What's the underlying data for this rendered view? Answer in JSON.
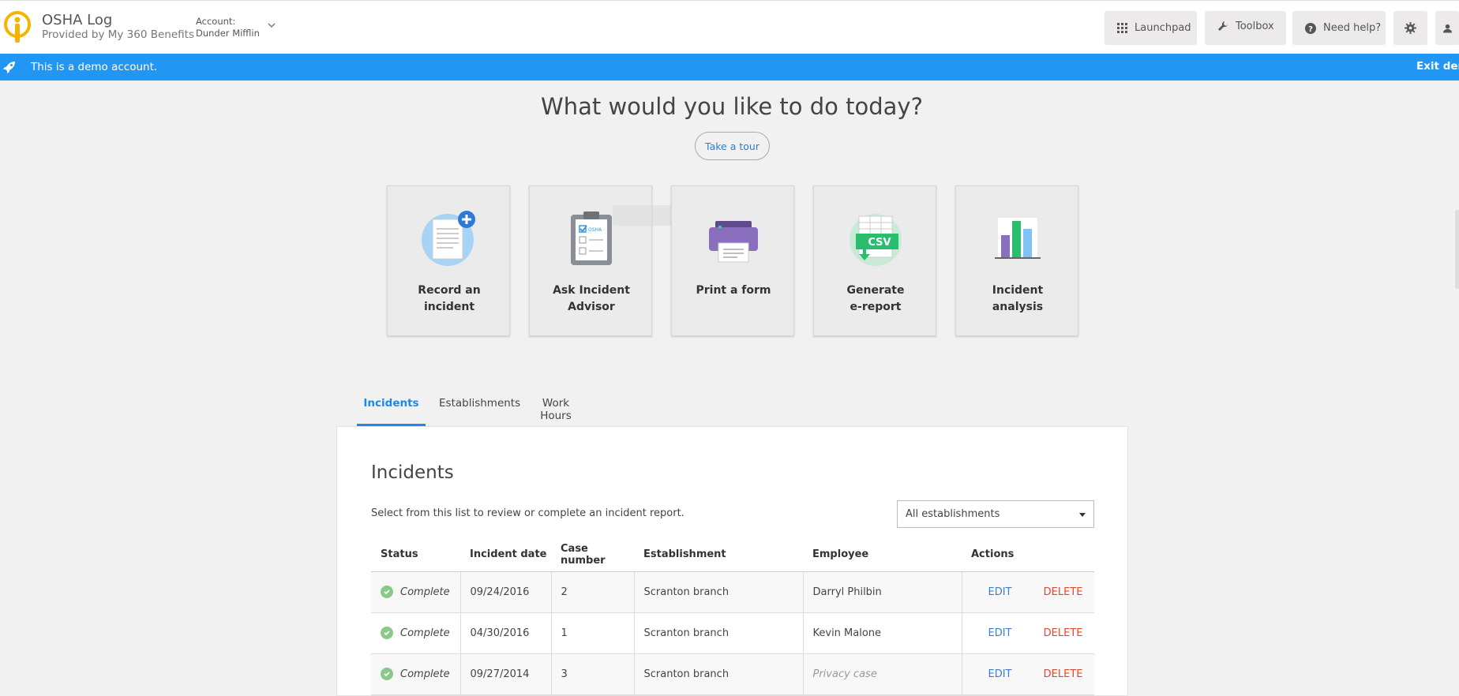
{
  "header": {
    "app_title": "OSHA Log",
    "app_subtitle": "Provided by My 360 Benefits",
    "account_label": "Account:",
    "account_name": "Dunder Mifflin",
    "launchpad": "Launchpad",
    "toolbox": "Toolbox",
    "help": "Need help?"
  },
  "demo_bar": {
    "text": "This is a demo account.",
    "exit": "Exit demo"
  },
  "main": {
    "heading": "What would you like to do today?",
    "tour": "Take a tour"
  },
  "cards": [
    {
      "label": "Record an\nincident",
      "icon": "record-incident-icon"
    },
    {
      "label": "Ask Incident\nAdvisor",
      "icon": "clipboard-icon"
    },
    {
      "label": "Print a form",
      "icon": "printer-icon"
    },
    {
      "label": "Generate\ne-report",
      "icon": "csv-icon"
    },
    {
      "label": "Incident\nanalysis",
      "icon": "bar-chart-icon"
    }
  ],
  "tabs": [
    "Incidents",
    "Establishments",
    "Work Hours"
  ],
  "panel": {
    "title": "Incidents",
    "description": "Select from this list to review or complete an incident report.",
    "filter": "All establishments",
    "columns": [
      "Status",
      "Incident date",
      "Case number",
      "Establishment",
      "Employee",
      "Actions"
    ],
    "rows": [
      {
        "status": "Complete",
        "date": "09/24/2016",
        "case": "2",
        "establishment": "Scranton branch",
        "employee": "Darryl Philbin",
        "edit": "EDIT",
        "delete": "DELETE"
      },
      {
        "status": "Complete",
        "date": "04/30/2016",
        "case": "1",
        "establishment": "Scranton branch",
        "employee": "Kevin Malone",
        "edit": "EDIT",
        "delete": "DELETE"
      },
      {
        "status": "Complete",
        "date": "09/27/2014",
        "case": "3",
        "establishment": "Scranton branch",
        "employee": "Privacy case",
        "edit": "EDIT",
        "delete": "DELETE"
      }
    ]
  },
  "colors": {
    "accent": "#2196f3",
    "logo": "#f5b400",
    "delete": "#e8492c",
    "edit": "#3b7fd4",
    "complete": "#8bc98b"
  }
}
